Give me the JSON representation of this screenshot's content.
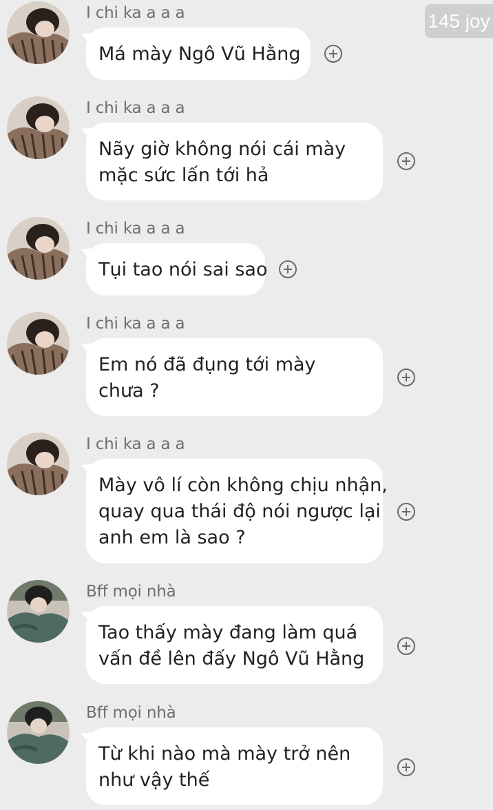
{
  "watermark": "145 joy",
  "messages": [
    {
      "sender": "I chi ka a a a",
      "avatar": "boy-striped-shirt",
      "lines": [
        "Má mày Ngô Vũ Hằng"
      ]
    },
    {
      "sender": "I chi ka a a a",
      "avatar": "boy-striped-shirt",
      "lines": [
        "Nãy giờ không nói cái mày",
        "mặc sức lấn tới hả"
      ]
    },
    {
      "sender": "I chi ka a a a",
      "avatar": "boy-striped-shirt",
      "lines": [
        "Tụi tao nói sai sao"
      ]
    },
    {
      "sender": "I chi ka a a a",
      "avatar": "boy-striped-shirt",
      "lines": [
        "Em nó đã đụng tới mày",
        "chưa ?"
      ]
    },
    {
      "sender": "I chi ka a a a",
      "avatar": "boy-striped-shirt",
      "lines": [
        "Mày vô lí còn không chịu nhận,",
        "quay qua thái độ nói ngược lại",
        "anh em là sao ?"
      ]
    },
    {
      "sender": "Bff mọi nhà",
      "avatar": "boy-green-jacket",
      "lines": [
        "Tao thấy mày đang làm quá",
        "vấn đề lên đấy Ngô Vũ Hằng"
      ]
    },
    {
      "sender": "Bff mọi nhà",
      "avatar": "boy-green-jacket",
      "lines": [
        "Từ khi nào mà mày trở nên",
        "như vậy thế"
      ]
    }
  ]
}
